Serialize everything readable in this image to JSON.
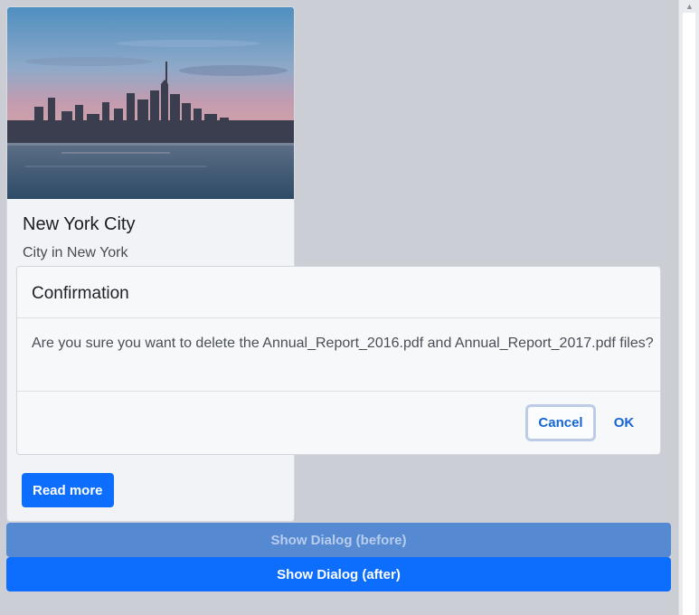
{
  "card": {
    "image_alt": "New York City skyline at sunset over the water",
    "title": "New York City",
    "subtitle": "City in New York",
    "read_more_label": "Read more"
  },
  "buttons": {
    "show_before_label": "Show Dialog (before)",
    "show_after_label": "Show Dialog (after)"
  },
  "dialog": {
    "title": "Confirmation",
    "message": "Are you sure you want to delete the Annual_Report_2016.pdf and Annual_Report_2017.pdf files?",
    "cancel_label": "Cancel",
    "ok_label": "OK"
  },
  "colors": {
    "primary": "#0d6efd",
    "primary_disabled": "#5589d2",
    "backdrop": "#cbced5",
    "dialog_bg": "#f7f8fa",
    "link": "#1565d6"
  }
}
